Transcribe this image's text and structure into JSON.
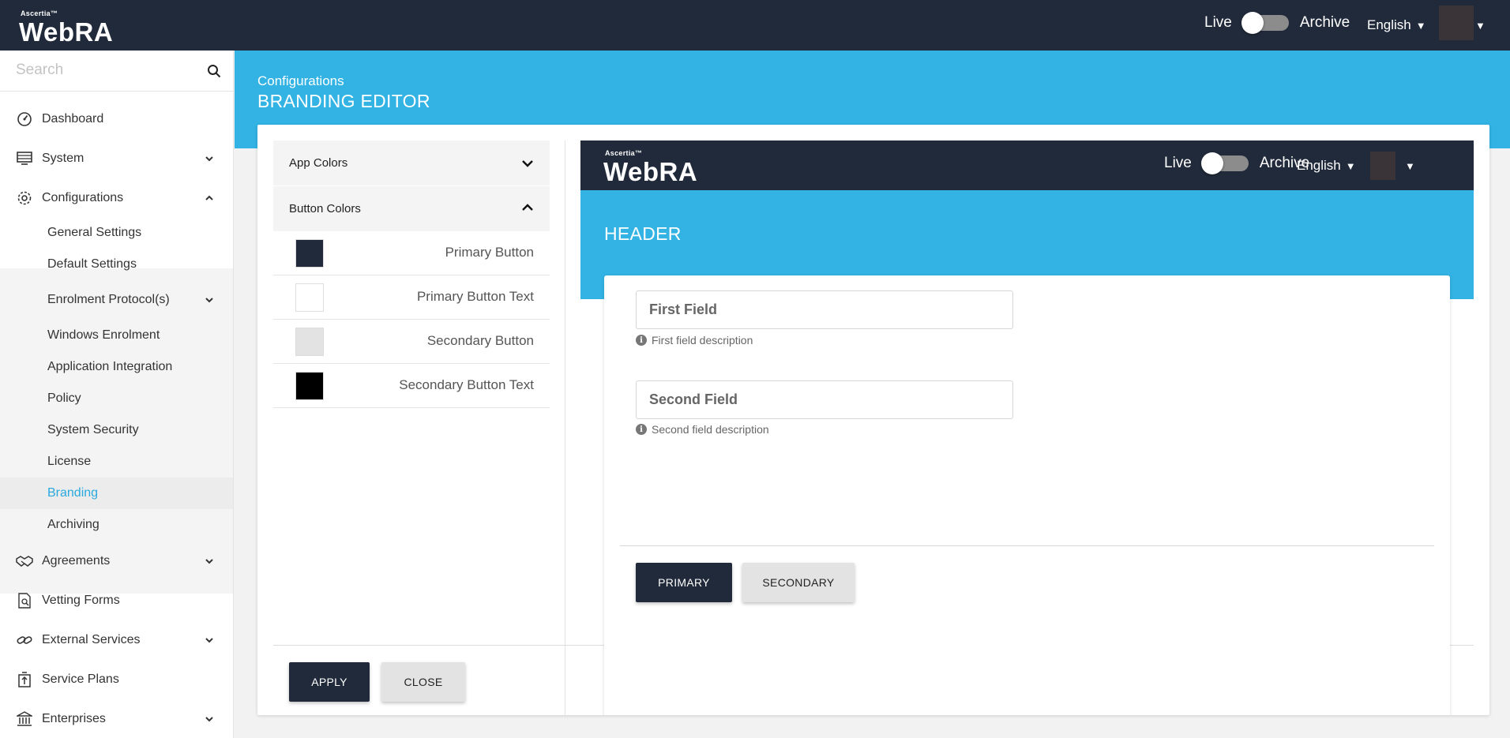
{
  "app": {
    "brand_small": "Ascertia™",
    "brand_main": "WebRA",
    "toggle_live": "Live",
    "toggle_archive": "Archive",
    "language": "English",
    "caret": "▼"
  },
  "sidebar": {
    "search_placeholder": "Search",
    "items": [
      {
        "label": "Dashboard",
        "icon": "dashboard-icon"
      },
      {
        "label": "System",
        "icon": "system-icon"
      },
      {
        "label": "Configurations",
        "icon": "gear-icon"
      },
      {
        "label": "Agreements",
        "icon": "handshake-icon"
      },
      {
        "label": "Vetting Forms",
        "icon": "vetting-icon"
      },
      {
        "label": "External Services",
        "icon": "link-icon"
      },
      {
        "label": "Service Plans",
        "icon": "service-plans-icon"
      },
      {
        "label": "Enterprises",
        "icon": "bank-icon"
      }
    ],
    "submenu": [
      "General Settings",
      "Default Settings",
      "Enrolment Protocol(s)",
      "Windows Enrolment",
      "Application Integration",
      "Policy",
      "System Security",
      "License",
      "Branding",
      "Archiving"
    ],
    "active_submenu": "Branding"
  },
  "page": {
    "breadcrumb": "Configurations",
    "title": "BRANDING EDITOR"
  },
  "editor": {
    "sections": [
      {
        "label": "App Colors",
        "expanded": false
      },
      {
        "label": "Button Colors",
        "expanded": true
      }
    ],
    "colors": [
      {
        "label": "Primary Button",
        "color": "#212a3b"
      },
      {
        "label": "Primary Button Text",
        "color": "#ffffff"
      },
      {
        "label": "Secondary Button",
        "color": "#e3e3e3"
      },
      {
        "label": "Secondary Button Text",
        "color": "#000000"
      }
    ],
    "apply_label": "APPLY",
    "close_label": "CLOSE"
  },
  "preview": {
    "header": "HEADER",
    "fields": [
      {
        "label": "First Field",
        "description": "First field description"
      },
      {
        "label": "Second Field",
        "description": "Second field description"
      }
    ],
    "primary_label": "PRIMARY",
    "secondary_label": "SECONDARY"
  },
  "colors": {
    "navy": "#212a3b",
    "accent": "#32b3e4",
    "active_link": "#2aa9de"
  }
}
